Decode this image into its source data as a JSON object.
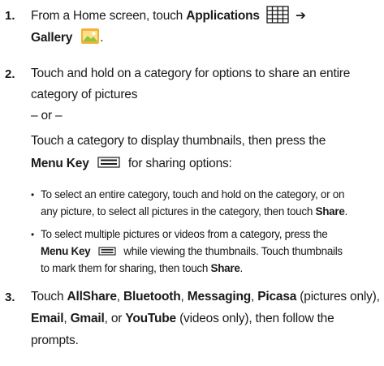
{
  "steps": [
    {
      "number": "1.",
      "line1": {
        "pre": "From a Home screen, touch ",
        "bold1": "Applications",
        "post": " ➔"
      },
      "line2": {
        "bold": "Gallery",
        "post": "."
      }
    },
    {
      "number": "2.",
      "line1": "Touch and hold on a category for options to share an entire",
      "line2": "category of pictures",
      "or_text": "– or –",
      "line3": "Touch a category to display thumbnails, then press the",
      "line4": {
        "bold": "Menu Key",
        "post": " for sharing options:"
      },
      "bullets": [
        {
          "line1": "To select an entire category, touch and hold on the category, or on",
          "line2": {
            "pre": "any picture, to select all pictures in the category, then touch ",
            "bold": "Share",
            "post": "."
          }
        },
        {
          "line1": "To select multiple pictures or videos from a category, press the",
          "line2": {
            "bold": "Menu Key",
            "post": " while viewing the thumbnails. Touch thumbnails"
          },
          "line3": {
            "pre": "to mark them for sharing, then touch ",
            "bold": "Share",
            "post": "."
          }
        }
      ]
    },
    {
      "number": "3.",
      "line1": {
        "pre": "Touch ",
        "b1": "AllShare",
        "s1": ", ",
        "b2": "Bluetooth",
        "s2": ", ",
        "b3": "Messaging",
        "s3": ", ",
        "b4": "Picasa",
        "post": " (pictures only),"
      },
      "line2": {
        "b1": "Email",
        "s1": ", ",
        "b2": "Gmail",
        "s2": ", or ",
        "b3": "YouTube",
        "post": " (videos only), then follow the"
      },
      "line3": "prompts."
    }
  ],
  "icons": {
    "applications": "grid-icon",
    "gallery": "gallery-icon",
    "menu_key": "menu-icon"
  }
}
